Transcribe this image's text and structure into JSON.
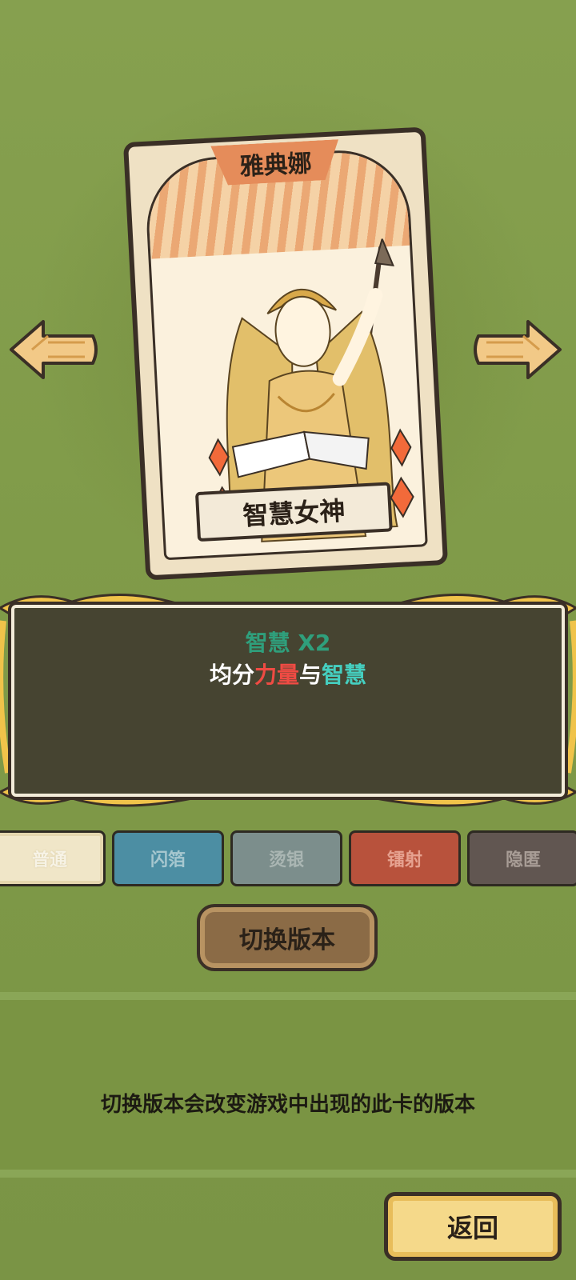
{
  "card": {
    "name": "雅典娜",
    "title": "智慧女神"
  },
  "description": {
    "line1": "智慧  X2",
    "line2_part1": "均分",
    "line2_part2": "力量",
    "line2_part3": "与",
    "line2_part4": "智慧"
  },
  "versions": {
    "items": [
      "普通",
      "闪箔",
      "烫银",
      "镭射",
      "隐匿"
    ],
    "selected": "普通"
  },
  "switch_button": {
    "label": "切换版本"
  },
  "info": {
    "text": "切换版本会改变游戏中出现的此卡的版本"
  },
  "return_button": {
    "label": "返回"
  },
  "colors": {
    "background": "#7f9a4a",
    "panel": "#464431",
    "accent_red": "#ef4b43",
    "accent_teal": "#45cfc0",
    "accent_green": "#2f9f7c"
  }
}
